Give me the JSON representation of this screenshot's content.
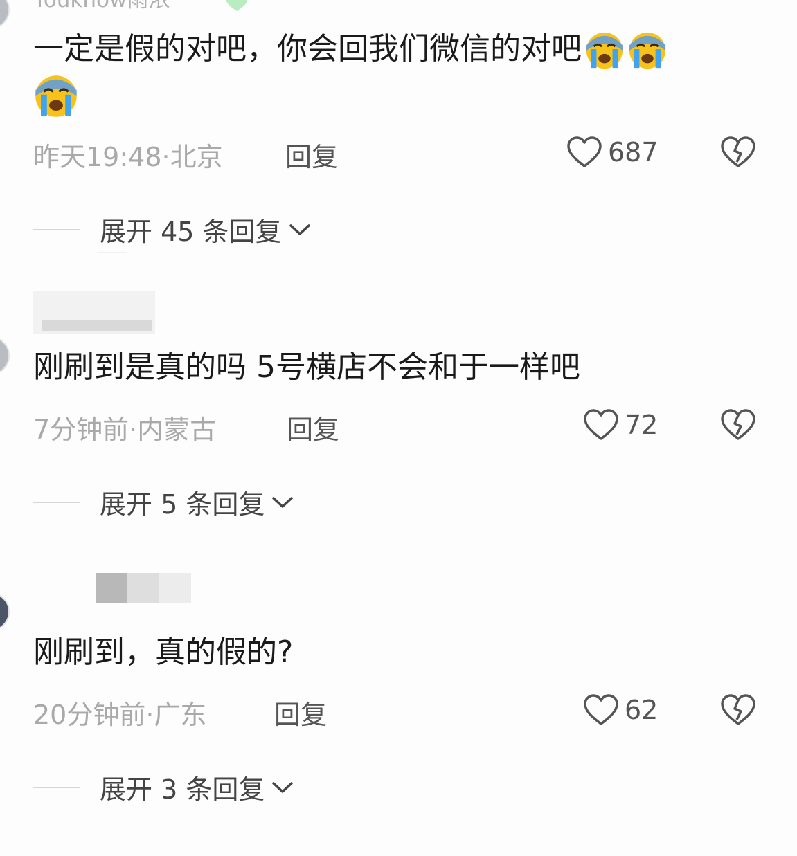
{
  "comments": [
    {
      "username": "Youknow雨浓",
      "text": "一定是假的对吧，你会回我们微信的对吧",
      "time_location": "昨天19:48·北京",
      "reply_label": "回复",
      "likes": "687",
      "expand_label": "展开 45 条回复"
    },
    {
      "username": "",
      "text": "刚刷到是真的吗 5号横店不会和于一样吧",
      "time_location": "7分钟前·内蒙古",
      "reply_label": "回复",
      "likes": "72",
      "expand_label": "展开 5 条回复"
    },
    {
      "username": "",
      "text": "刚刷到，真的假的?",
      "time_location": "20分钟前·广东",
      "reply_label": "回复",
      "likes": "62",
      "expand_label": "展开 3 条回复"
    }
  ],
  "icons": {
    "like": "heart-outline-icon",
    "dislike": "broken-heart-icon",
    "expand": "chevron-down-icon",
    "emoji": "loudly-crying-face-emoji"
  },
  "colors": {
    "text": "#1a1a1a",
    "meta": "#a9a9a9",
    "action": "#555555",
    "emoji_face": "#f7c21a",
    "emoji_tears": "#3fa3f0"
  }
}
